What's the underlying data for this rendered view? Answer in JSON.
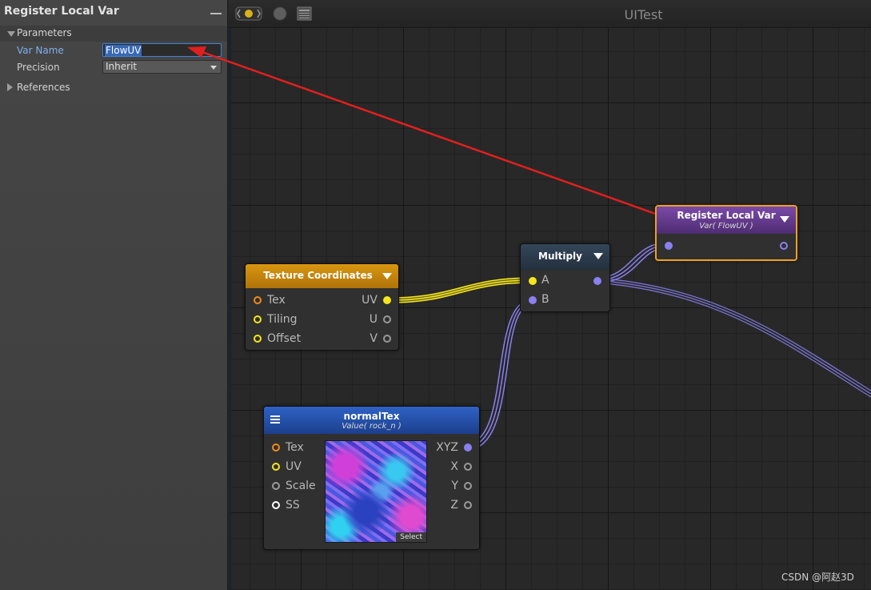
{
  "panel": {
    "title": "Register Local Var",
    "parameters_label": "Parameters",
    "var_name_label": "Var Name",
    "var_name_value": "FlowUV",
    "precision_label": "Precision",
    "precision_value": "Inherit",
    "references_label": "References"
  },
  "graph": {
    "title": "UITest"
  },
  "nodes": {
    "register_local_var": {
      "title": "Register Local Var",
      "subtitle": "Var( FlowUV )"
    },
    "multiply": {
      "title": "Multiply",
      "inputs": [
        "A",
        "B"
      ]
    },
    "texture_coordinates": {
      "title": "Texture Coordinates",
      "inputs": [
        "Tex",
        "Tiling",
        "Offset"
      ],
      "outputs": [
        "UV",
        "U",
        "V"
      ]
    },
    "normal_tex": {
      "title": "normalTex",
      "subtitle": "Value( rock_n )",
      "inputs": [
        "Tex",
        "UV",
        "Scale",
        "SS"
      ],
      "outputs": [
        "XYZ",
        "X",
        "Y",
        "Z"
      ],
      "preview_button": "Select"
    }
  },
  "colors": {
    "accent_selected": "#f0a020",
    "texcoord_header": "#c98a10",
    "reglocal_header": "#6a3a90",
    "normal_header": "#2450a8",
    "multiply_header": "#2d3a48",
    "annotation_arrow": "#e0201e"
  },
  "icons": {
    "toolbar": [
      "live-preview-icon",
      "circle-icon",
      "window-icon"
    ]
  },
  "watermark": "CSDN @阿赵3D"
}
